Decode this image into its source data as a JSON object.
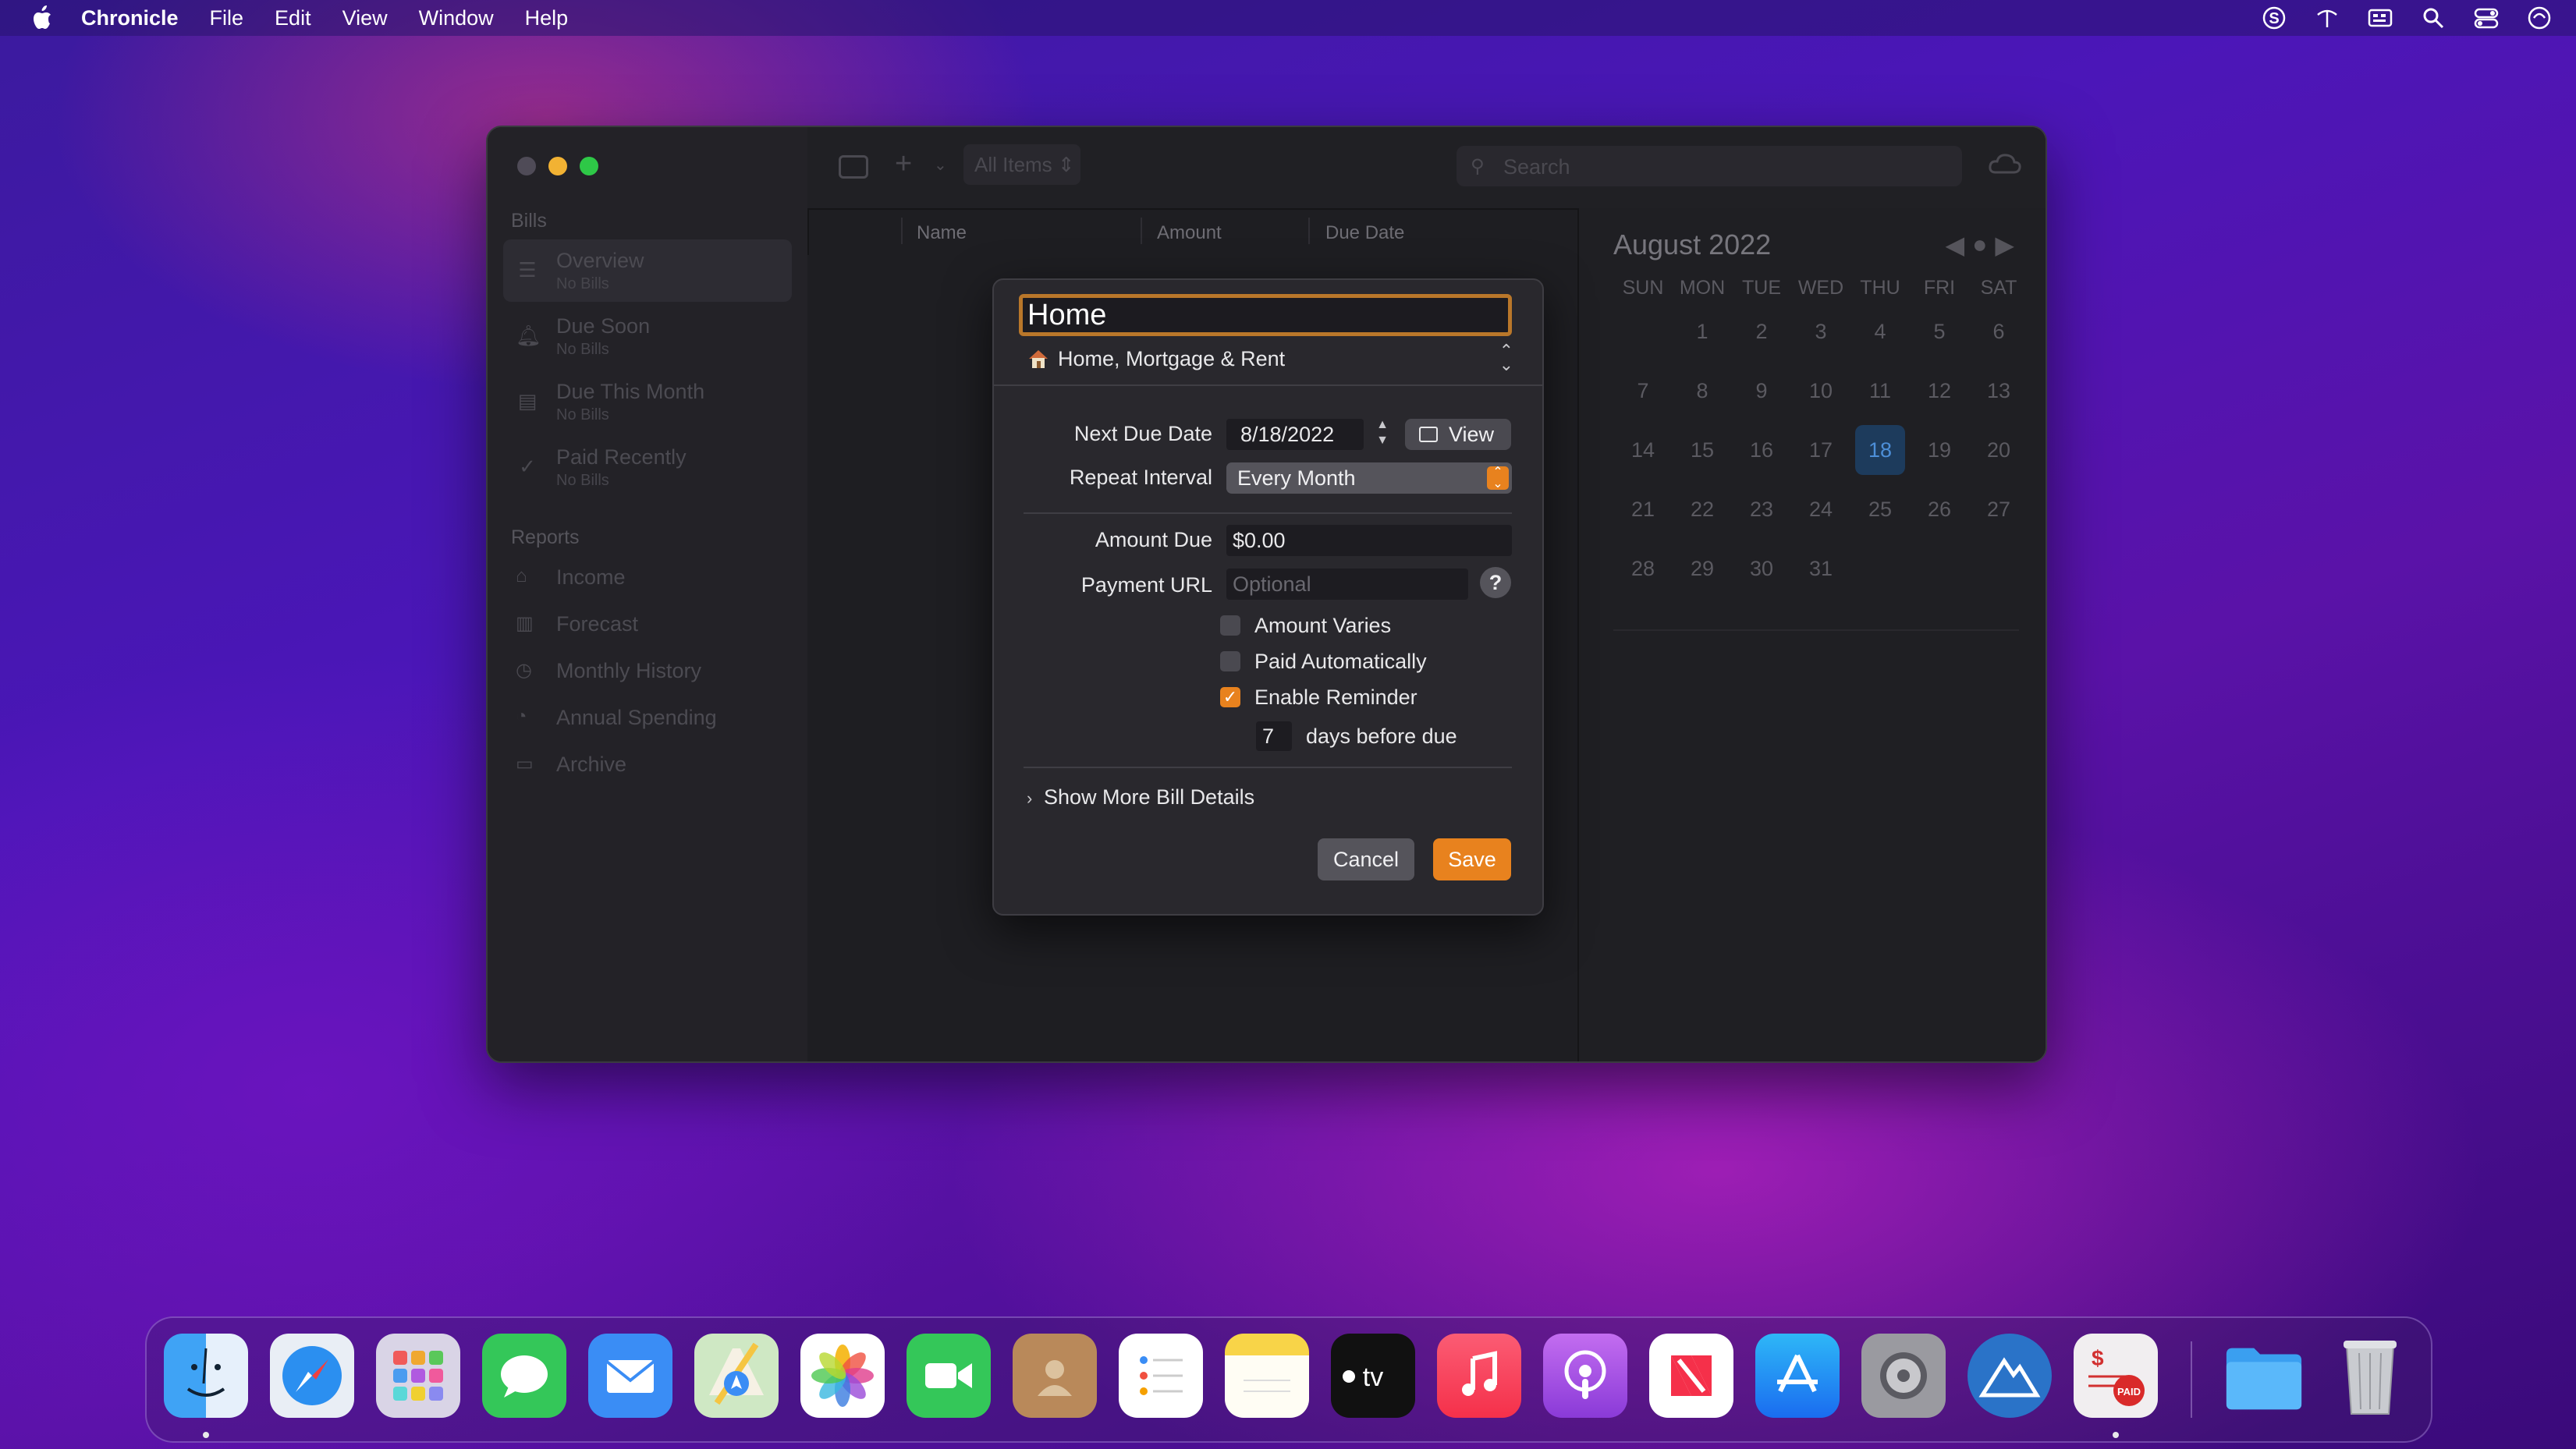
{
  "menubar": {
    "app_name": "Chronicle",
    "items": [
      "File",
      "Edit",
      "View",
      "Window",
      "Help"
    ],
    "right_icons": [
      "s-circle-icon",
      "wifi-off-icon",
      "keyboard-icon",
      "search-icon",
      "control-center-icon",
      "siri-icon"
    ]
  },
  "window": {
    "sidebar": {
      "bills_heading": "Bills",
      "items": [
        {
          "title": "Overview",
          "sub": "No Bills",
          "icon": "list-icon"
        },
        {
          "title": "Due Soon",
          "sub": "No Bills",
          "icon": "bell-icon"
        },
        {
          "title": "Due This Month",
          "sub": "No Bills",
          "icon": "calendar-icon"
        },
        {
          "title": "Paid Recently",
          "sub": "No Bills",
          "icon": "checkmark-icon"
        }
      ],
      "reports_heading": "Reports",
      "reports": [
        {
          "title": "Income",
          "icon": "bank-icon"
        },
        {
          "title": "Forecast",
          "icon": "bar-chart-icon"
        },
        {
          "title": "Monthly History",
          "icon": "clock-icon"
        },
        {
          "title": "Annual Spending",
          "icon": "pie-chart-icon"
        },
        {
          "title": "Archive",
          "icon": "archive-box-icon"
        }
      ]
    },
    "toolbar": {
      "filter": "All Items",
      "search_placeholder": "Search"
    },
    "columns": [
      "Name",
      "Amount",
      "Due Date"
    ],
    "calendar": {
      "title": "August 2022",
      "weekdays": [
        "SUN",
        "MON",
        "TUE",
        "WED",
        "THU",
        "FRI",
        "SAT"
      ],
      "days": [
        "1",
        "2",
        "3",
        "4",
        "5",
        "6",
        "7",
        "8",
        "9",
        "10",
        "11",
        "12",
        "13",
        "14",
        "15",
        "16",
        "17",
        "18",
        "19",
        "20",
        "21",
        "22",
        "23",
        "24",
        "25",
        "26",
        "27",
        "28",
        "29",
        "30",
        "31"
      ],
      "first_weekday_index": 1,
      "today": "18"
    }
  },
  "sheet": {
    "name_value": "Home",
    "category": "Home, Mortgage & Rent",
    "next_due_label": "Next Due Date",
    "next_due_value": "8/18/2022",
    "view_label": "View",
    "repeat_label": "Repeat Interval",
    "repeat_value": "Every Month",
    "amount_label": "Amount Due",
    "amount_value": "$0.00",
    "payment_url_label": "Payment URL",
    "payment_url_placeholder": "Optional",
    "help_label": "?",
    "amount_varies": "Amount Varies",
    "amount_varies_checked": false,
    "paid_auto": "Paid Automatically",
    "paid_auto_checked": false,
    "enable_reminder": "Enable Reminder",
    "enable_reminder_checked": true,
    "reminder_days": "7",
    "days_before_label": "days before due",
    "show_more": "Show More Bill Details",
    "cancel": "Cancel",
    "save": "Save",
    "accent_color": "#e8821e"
  },
  "dock": {
    "apps": [
      "Finder",
      "Safari",
      "Launchpad",
      "Messages",
      "Mail",
      "Maps",
      "Photos",
      "FaceTime",
      "Contacts",
      "Reminders",
      "Notes",
      "TV",
      "Music",
      "Podcasts",
      "News",
      "App Store",
      "System Preferences",
      "Altitude",
      "Chronicle",
      "Downloads",
      "Trash"
    ]
  }
}
